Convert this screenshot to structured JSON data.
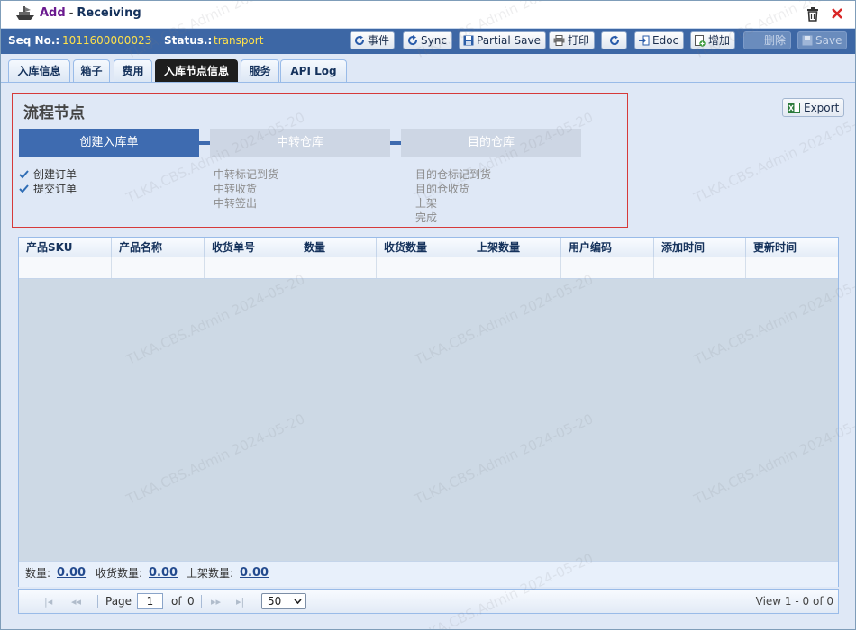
{
  "window": {
    "title_action": "Add",
    "title_separator": "-",
    "title_main": "Receiving"
  },
  "toolbar": {
    "seq_label": "Seq No.:",
    "seq_value": "1011600000023",
    "status_label": "Status.:",
    "status_value": "transport",
    "buttons": {
      "event": "事件",
      "sync": "Sync",
      "partial_save": "Partial Save",
      "print": "打印",
      "edoc": "Edoc",
      "add": "增加",
      "delete": "删除",
      "save": "Save"
    }
  },
  "tabs": [
    "入库信息",
    "箱子",
    "费用",
    "入库节点信息",
    "服务",
    "API Log"
  ],
  "active_tab_index": 3,
  "flow": {
    "title": "流程节点",
    "steps": [
      {
        "label": "创建入库单",
        "active": true,
        "items": [
          "创建订单",
          "提交订单"
        ],
        "done": true
      },
      {
        "label": "中转仓库",
        "active": false,
        "items": [
          "中转标记到货",
          "中转收货",
          "中转签出"
        ],
        "done": false
      },
      {
        "label": "目的仓库",
        "active": false,
        "items": [
          "目的仓标记到货",
          "目的仓收货",
          "上架",
          "完成"
        ],
        "done": false
      }
    ]
  },
  "export_label": "Export",
  "grid": {
    "columns": [
      "产品SKU",
      "产品名称",
      "收货单号",
      "数量",
      "收货数量",
      "上架数量",
      "用户编码",
      "添加时间",
      "更新时间"
    ],
    "summary": {
      "qty_label": "数量:",
      "qty_value": "0.00",
      "received_label": "收货数量:",
      "received_value": "0.00",
      "shelved_label": "上架数量:",
      "shelved_value": "0.00"
    }
  },
  "pager": {
    "page_label": "Page",
    "page_value": "1",
    "of_label": "of",
    "total_pages": "0",
    "page_size": "50",
    "view_text": "View 1 - 0 of 0"
  },
  "watermark": "TLKA.CBS.Admin 2024-05-20"
}
